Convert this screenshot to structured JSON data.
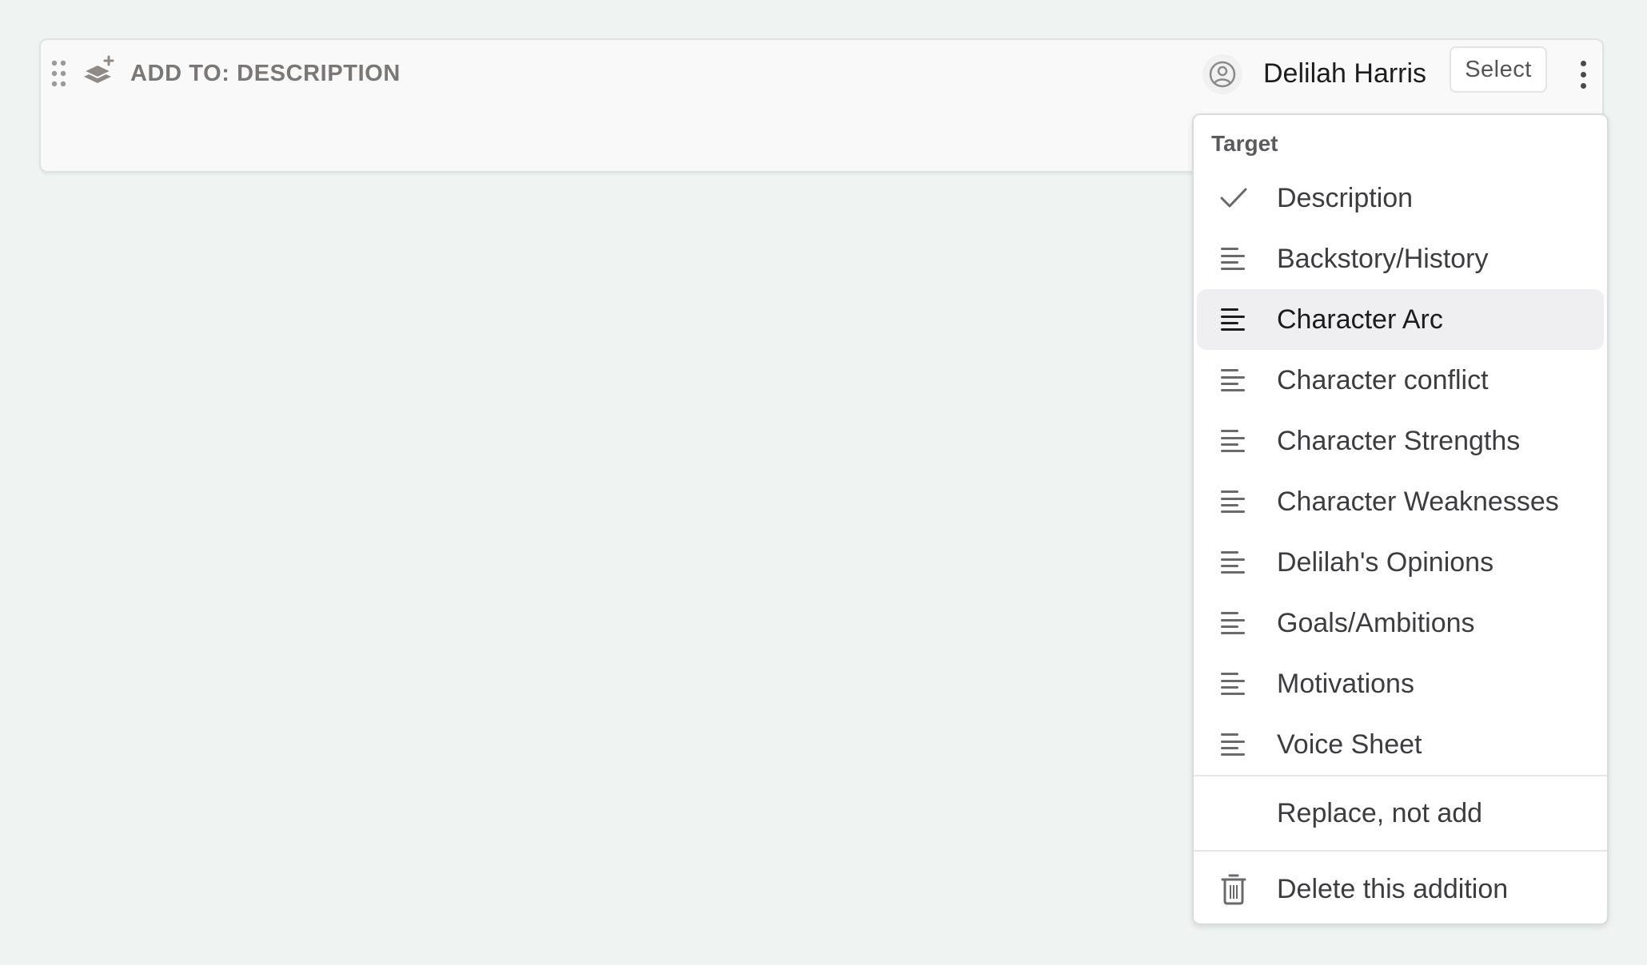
{
  "card": {
    "title": "ADD TO: DESCRIPTION",
    "icon": "layers-plus-icon",
    "drag_icon": "drag-handle-icon",
    "person": {
      "icon": "user-circle-icon",
      "name": "Delilah Harris"
    },
    "select_label": "Select",
    "more_icon": "more-vertical-icon"
  },
  "menu": {
    "header": "Target",
    "targets": [
      {
        "label": "Description",
        "icon": "check-icon",
        "selected": true,
        "hovered": false
      },
      {
        "label": "Backstory/History",
        "icon": "text-align-left-icon",
        "selected": false,
        "hovered": false
      },
      {
        "label": "Character Arc",
        "icon": "text-align-left-icon",
        "selected": false,
        "hovered": true
      },
      {
        "label": "Character conflict",
        "icon": "text-align-left-icon",
        "selected": false,
        "hovered": false
      },
      {
        "label": "Character Strengths",
        "icon": "text-align-left-icon",
        "selected": false,
        "hovered": false
      },
      {
        "label": "Character Weaknesses",
        "icon": "text-align-left-icon",
        "selected": false,
        "hovered": false
      },
      {
        "label": "Delilah's Opinions",
        "icon": "text-align-left-icon",
        "selected": false,
        "hovered": false
      },
      {
        "label": "Goals/Ambitions",
        "icon": "text-align-left-icon",
        "selected": false,
        "hovered": false
      },
      {
        "label": "Motivations",
        "icon": "text-align-left-icon",
        "selected": false,
        "hovered": false
      },
      {
        "label": "Voice Sheet",
        "icon": "text-align-left-icon",
        "selected": false,
        "hovered": false
      }
    ],
    "replace_label": "Replace, not add",
    "delete_label": "Delete this addition",
    "delete_icon": "trash-icon"
  },
  "colors": {
    "background": "#eff4f3",
    "card_bg": "#f9f9f9",
    "menu_bg": "#ffffff",
    "hover_bg": "#efeff1",
    "title_text": "#7a7876",
    "icon_gray": "#8a8886"
  }
}
